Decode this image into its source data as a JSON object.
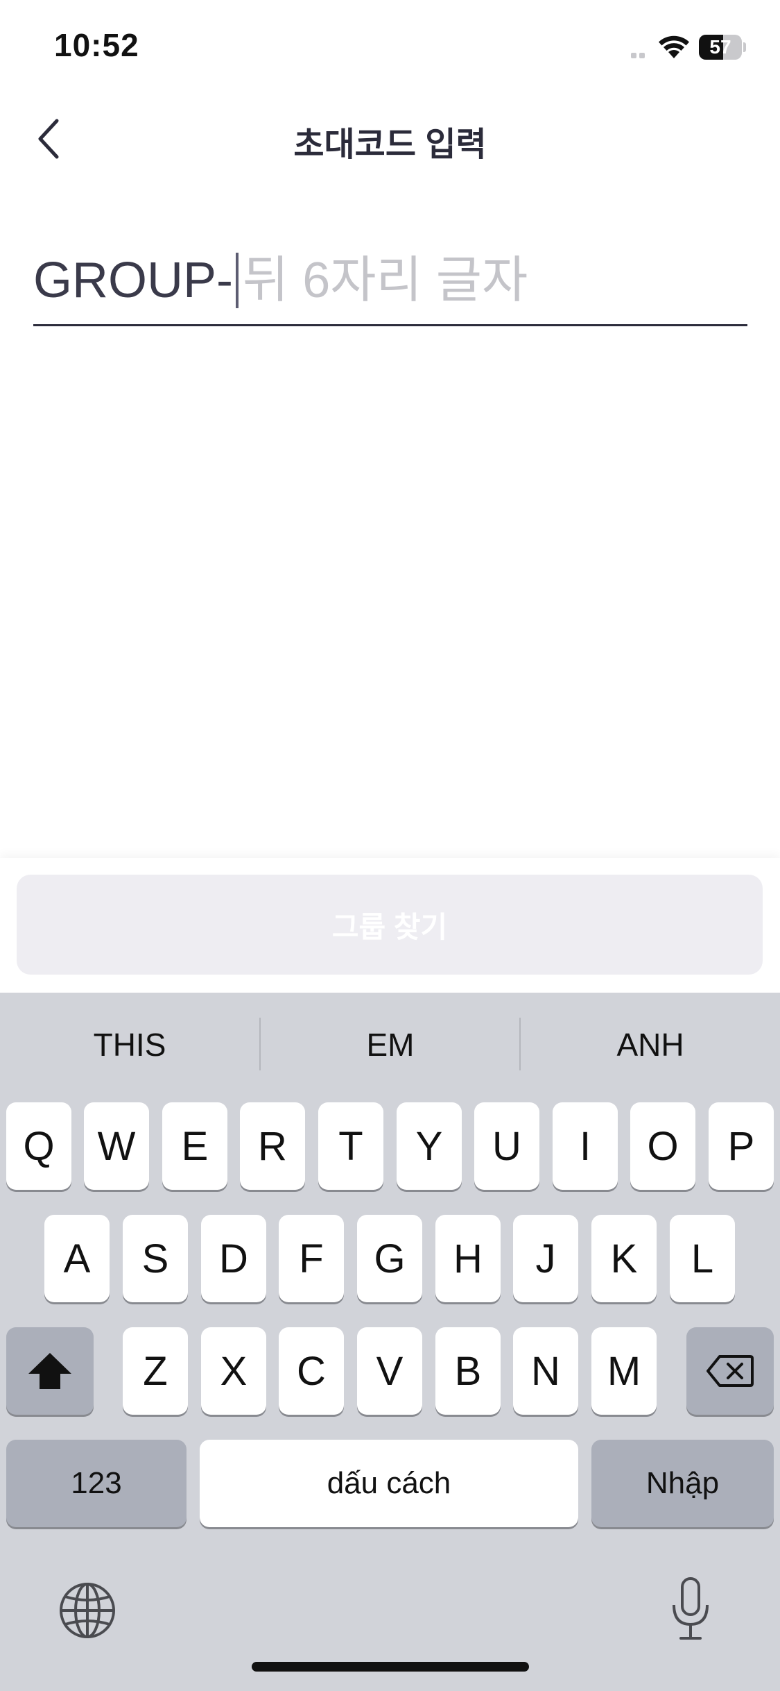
{
  "status_bar": {
    "time": "10:52",
    "battery_level": "57",
    "battery_fraction": 0.57
  },
  "header": {
    "title": "초대코드 입력",
    "back_icon": "chevron-left-icon"
  },
  "code_input": {
    "prefix": "GROUP-",
    "value": "",
    "placeholder": "뒤 6자리 글자"
  },
  "action": {
    "find_group_label": "그룹 찾기",
    "enabled": false
  },
  "keyboard": {
    "suggestions": [
      "THIS",
      "EM",
      "ANH"
    ],
    "row1": [
      "Q",
      "W",
      "E",
      "R",
      "T",
      "Y",
      "U",
      "I",
      "O",
      "P"
    ],
    "row2": [
      "A",
      "S",
      "D",
      "F",
      "G",
      "H",
      "J",
      "K",
      "L"
    ],
    "row3": [
      "Z",
      "X",
      "C",
      "V",
      "B",
      "N",
      "M"
    ],
    "numbers_label": "123",
    "space_label": "dấu cách",
    "return_label": "Nhập",
    "shift_icon": "shift-icon",
    "delete_icon": "delete-icon",
    "globe_icon": "globe-icon",
    "mic_icon": "microphone-icon"
  },
  "colors": {
    "title_text": "#2b2b3a",
    "placeholder": "#c4c4c9",
    "button_disabled_bg": "#eeedf2",
    "keyboard_bg": "#d1d3d9"
  }
}
